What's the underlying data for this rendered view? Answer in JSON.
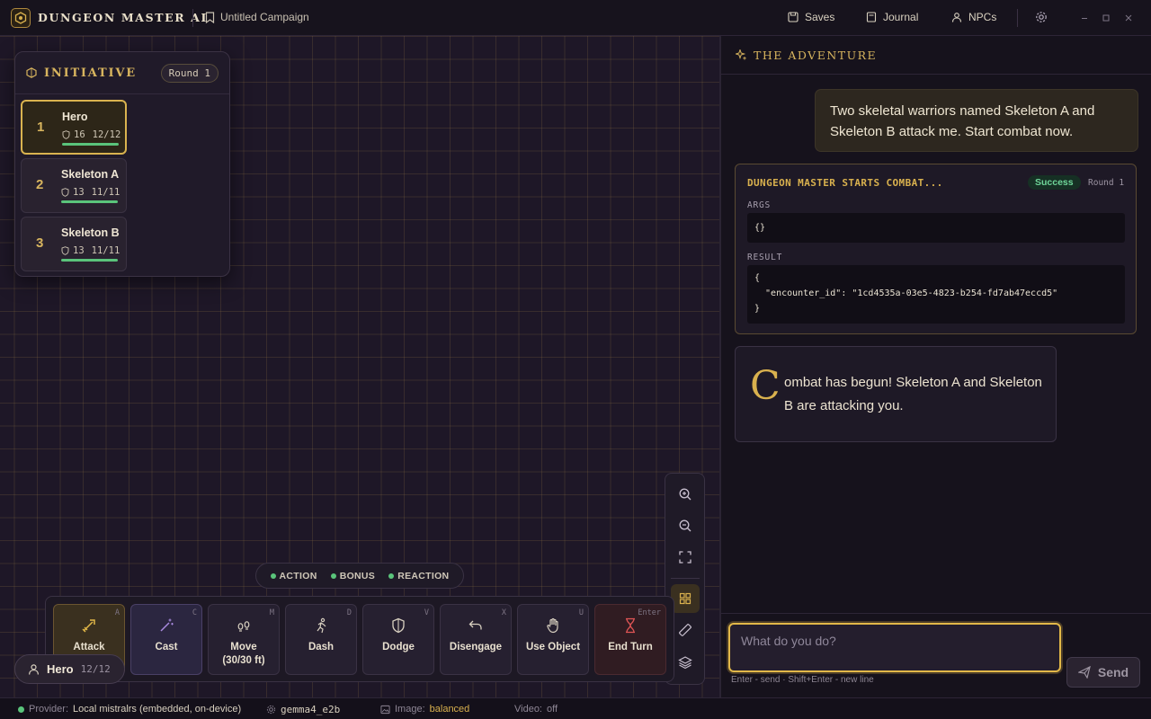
{
  "titlebar": {
    "app_name": "DUNGEON MASTER AI",
    "campaign": "Untitled Campaign",
    "saves": "Saves",
    "journal": "Journal",
    "npcs": "NPCs"
  },
  "initiative": {
    "title": "INITIATIVE",
    "round": "Round 1",
    "combatants": [
      {
        "order": "1",
        "name": "Hero",
        "ac": "16",
        "hp": "12/12",
        "hp_fraction": 1.0,
        "active": true
      },
      {
        "order": "2",
        "name": "Skeleton A",
        "ac": "13",
        "hp": "11/11",
        "hp_fraction": 1.0,
        "active": false
      },
      {
        "order": "3",
        "name": "Skeleton B",
        "ac": "13",
        "hp": "11/11",
        "hp_fraction": 1.0,
        "active": false
      }
    ]
  },
  "economy": {
    "action": "ACTION",
    "bonus": "BONUS",
    "reaction": "REACTION"
  },
  "actions": [
    {
      "label": "Attack",
      "sub": "",
      "key": "A",
      "icon": "sword-icon"
    },
    {
      "label": "Cast",
      "sub": "",
      "key": "C",
      "icon": "wand-icon"
    },
    {
      "label": "Move",
      "sub": "(30/30 ft)",
      "key": "M",
      "icon": "footsteps-icon"
    },
    {
      "label": "Dash",
      "sub": "",
      "key": "D",
      "icon": "running-icon"
    },
    {
      "label": "Dodge",
      "sub": "",
      "key": "V",
      "icon": "shield-icon"
    },
    {
      "label": "Disengage",
      "sub": "",
      "key": "X",
      "icon": "undo-arrow-icon"
    },
    {
      "label": "Use Object",
      "sub": "",
      "key": "U",
      "icon": "hand-icon"
    },
    {
      "label": "End Turn",
      "sub": "",
      "key": "Enter",
      "icon": "hourglass-icon"
    }
  ],
  "hero_pill": {
    "name": "Hero",
    "hp": "12/12"
  },
  "adventure": {
    "title": "THE ADVENTURE",
    "user_message": "Two skeletal warriors named Skeleton A and Skeleton B attack me. Start combat now.",
    "tool_card": {
      "title": "DUNGEON MASTER STARTS COMBAT...",
      "status": "Success",
      "round": "Round 1",
      "args_label": "ARGS",
      "args": "{}",
      "result_label": "RESULT",
      "result": "{\n  \"encounter_id\": \"1cd4535a-03e5-4823-b254-fd7ab47eccd5\"\n}"
    },
    "dm_drop_cap": "C",
    "dm_text": "ombat has begun! Skeleton A and Skeleton B are attacking you."
  },
  "composer": {
    "placeholder": "What do you do?",
    "send": "Send",
    "hint": "Enter - send · Shift+Enter - new line"
  },
  "statusbar": {
    "provider_label": "Provider:",
    "provider": "Local mistralrs (embedded, on-device)",
    "model": "gemma4_e2b",
    "image_label": "Image:",
    "image": "balanced",
    "video_label": "Video:",
    "video": "off"
  },
  "colors": {
    "accent": "#d9b14e",
    "success": "#5ac47b",
    "background": "#16121d"
  }
}
